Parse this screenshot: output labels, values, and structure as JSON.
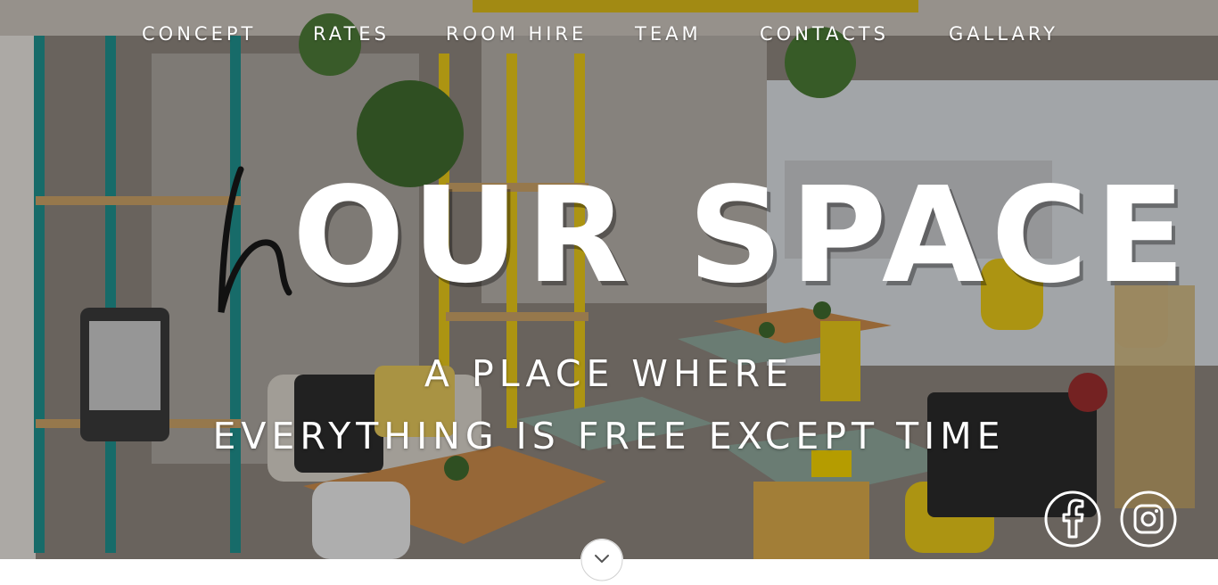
{
  "nav": {
    "items": [
      {
        "label": "CONCEPT"
      },
      {
        "label": "RATES"
      },
      {
        "label": "ROOM HIRE"
      },
      {
        "label": "TEAM"
      },
      {
        "label": "CONTACTS"
      },
      {
        "label": "GALLARY"
      }
    ]
  },
  "hero": {
    "logo_script_letter": "h",
    "logo_text": "OUR SPACE",
    "tagline_line1": "A PLACE WHERE",
    "tagline_line2": "EVERYTHING IS FREE EXCEPT TIME"
  },
  "social": {
    "facebook_icon": "facebook-icon",
    "instagram_icon": "instagram-icon"
  },
  "scroll": {
    "icon": "chevron-down-icon"
  },
  "colors": {
    "text": "#ffffff",
    "overlay": "#000000",
    "teal_shelf": "#1f8f8c",
    "yellow_shelf": "#e6c619"
  }
}
